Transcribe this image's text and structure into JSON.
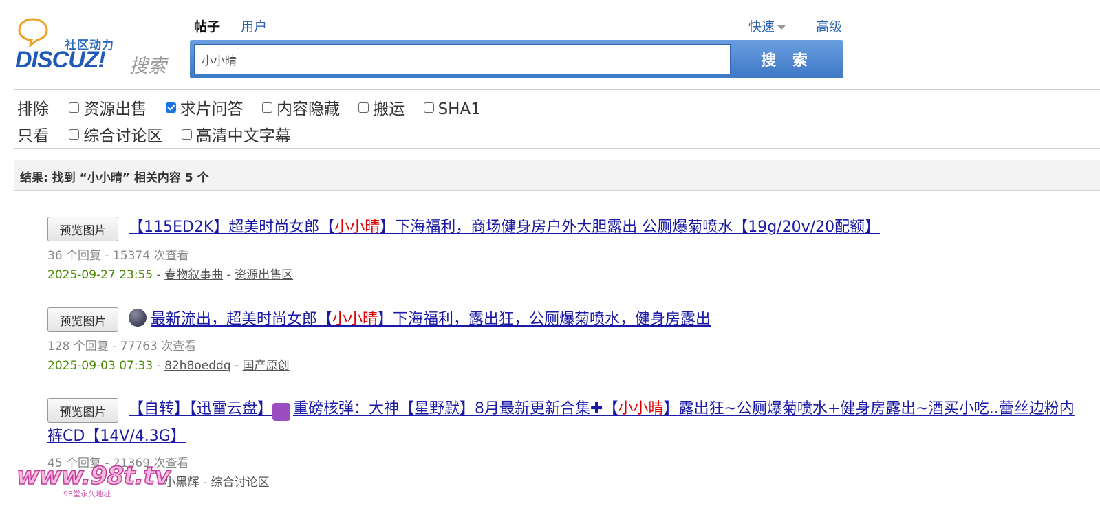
{
  "logo": {
    "tagline": "社区动力",
    "brand": "DISCUZ!",
    "search_word": "搜索"
  },
  "search_types": [
    {
      "label": "帖子",
      "active": true
    },
    {
      "label": "用户",
      "active": false
    }
  ],
  "modes": {
    "quick": "快速",
    "advanced": "高级"
  },
  "search": {
    "value": "小小晴",
    "button": "搜 索"
  },
  "filters": {
    "exclude_label": "排除",
    "exclude_options": [
      {
        "label": "资源出售",
        "checked": false
      },
      {
        "label": "求片问答",
        "checked": true
      },
      {
        "label": "内容隐藏",
        "checked": false
      },
      {
        "label": "搬运",
        "checked": false
      },
      {
        "label": "SHA1",
        "checked": false
      }
    ],
    "only_label": "只看",
    "only_options": [
      {
        "label": "综合讨论区",
        "checked": false
      },
      {
        "label": "高清中文字幕",
        "checked": false
      }
    ]
  },
  "results_summary": "结果: 找到 “小小晴” 相关内容 5 个",
  "results": [
    {
      "preview_label": "预览图片",
      "title_before": "【115ED2K】超美时尚女郎【",
      "title_highlight": "小小晴",
      "title_after": "】下海福利，商场健身房户外大胆露出 公厕爆菊喷水【19g/20v/20配额】",
      "stats": "36 个回复 - 15374 次查看",
      "date": "2025-09-27 23:55",
      "author": "春物叙事曲",
      "forum": "资源出售区"
    },
    {
      "preview_label": "预览图片",
      "title_icon": "black-circle-icon",
      "title_before": "最新流出，超美时尚女郎【",
      "title_highlight": "小小晴",
      "title_after": "】下海福利，露出狂，公厕爆菊喷水，健身房露出",
      "stats": "128 个回复 - 77763 次查看",
      "date": "2025-09-03 07:33",
      "author": "82h8oeddq",
      "forum": "国产原创"
    },
    {
      "preview_label": "预览图片",
      "title_part1": "【自转】【迅雷云盘】",
      "aries_glyph": "♈",
      "title_part2": "重磅核弹：大神【星野默】8月最新更新合集",
      "plus_glyph": "✚",
      "title_part3": "【",
      "title_highlight": "小小晴",
      "title_after": "】露出狂~公厕爆菊喷水+健身房露出~酒买小吃..蕾丝边粉内裤CD【14V/4.3G】",
      "stats": "45 个回复 - 21369 次查看",
      "author": "小黑辉",
      "forum": "综合讨论区"
    }
  ],
  "meta_separator": " - ",
  "watermark": {
    "text": "www.98t.tv",
    "sub": "98堂永久地址"
  }
}
